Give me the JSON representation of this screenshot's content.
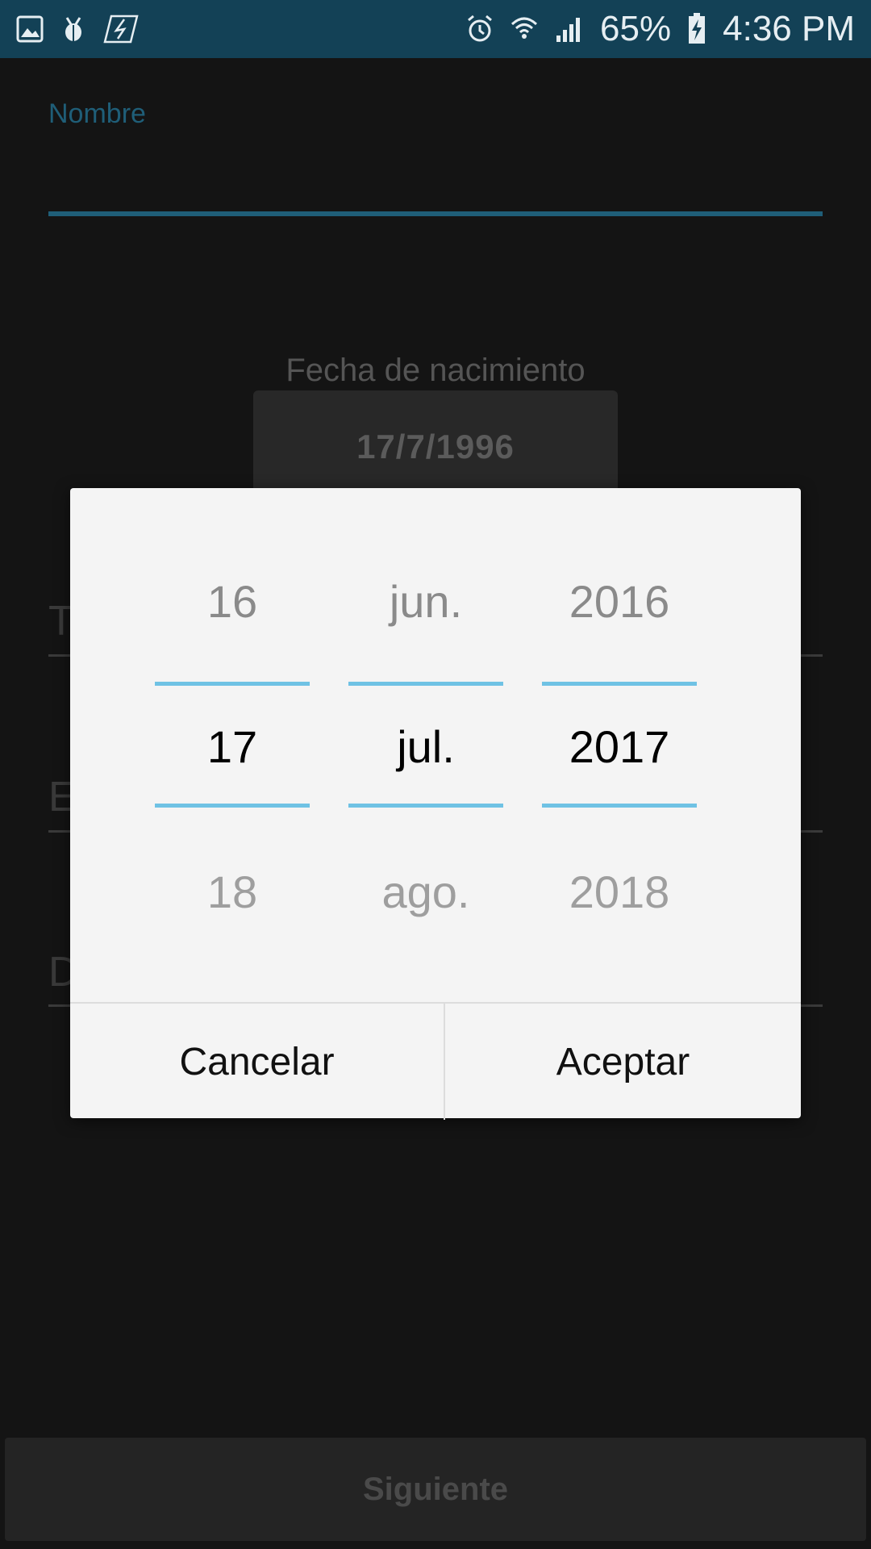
{
  "status_bar": {
    "battery_percent": "65%",
    "time": "4:36 PM",
    "left_icons": [
      "gallery-icon",
      "bug-icon",
      "flash-card-icon"
    ],
    "right_icons": [
      "alarm-icon",
      "wifi-icon",
      "signal-icon",
      "battery-charging-icon"
    ]
  },
  "form": {
    "name_label": "Nombre",
    "birth_label": "Fecha de nacimiento",
    "birth_value": "17/7/1996",
    "field_letters": [
      "T",
      "E",
      "D"
    ],
    "next_button": "Siguiente"
  },
  "date_picker": {
    "day": {
      "prev": "16",
      "selected": "17",
      "next": "18"
    },
    "month": {
      "prev": "jun.",
      "selected": "jul.",
      "next": "ago."
    },
    "year": {
      "prev": "2016",
      "selected": "2017",
      "next": "2018"
    },
    "cancel_label": "Cancelar",
    "accept_label": "Aceptar"
  },
  "colors": {
    "accent": "#6fc2e4",
    "status_bar": "#134156",
    "background": "#141414",
    "dialog": "#f4f4f4"
  }
}
